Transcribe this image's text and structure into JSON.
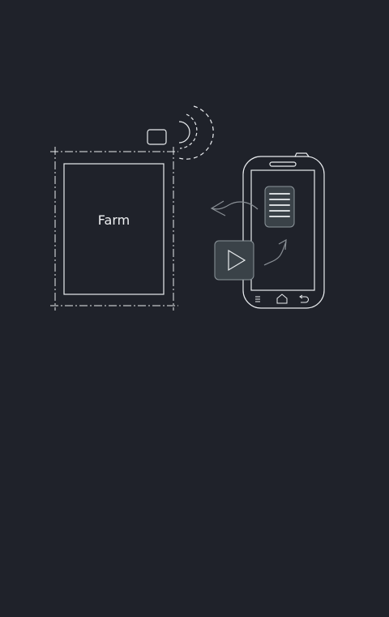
{
  "illustration": {
    "farm_label": "Farm",
    "icons": {
      "sensor": "sensor-device-icon",
      "signal": "wireless-signal-icon",
      "phone": "smartphone-icon",
      "document_card": "document-card-icon",
      "play_button": "play-button-icon",
      "arrow_to_farm": "curved-arrow-left-icon",
      "arrow_to_document": "curved-arrow-up-icon",
      "nav_menu": "menu-icon",
      "nav_home": "home-icon",
      "nav_back": "back-icon"
    }
  },
  "colors": {
    "background": "#1f222a",
    "line": "#e9ecef",
    "arrow": "#8a9096",
    "card_fill": "#3a4248",
    "card_stroke": "#8c959b"
  }
}
